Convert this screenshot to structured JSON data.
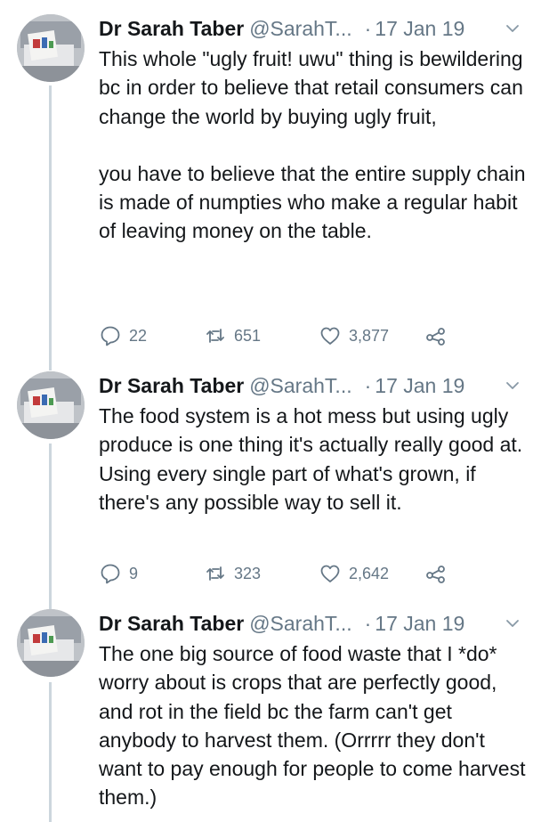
{
  "tweets": [
    {
      "author_name": "Dr Sarah Taber",
      "author_handle": "@SarahT...",
      "separator": "·",
      "date": "17 Jan 19",
      "paragraphs": [
        "This whole \"ugly fruit! uwu\" thing is bewildering bc in order to believe that retail consumers can change the world by buying ugly fruit,",
        "you have to believe that the entire supply chain is made of numpties who make a regular habit of leaving money on the table."
      ],
      "replies": "22",
      "retweets": "651",
      "likes": "3,877"
    },
    {
      "author_name": "Dr Sarah Taber",
      "author_handle": "@SarahT...",
      "separator": "·",
      "date": "17 Jan 19",
      "paragraphs": [
        "The food system is a hot mess but using ugly produce is one thing it's actually really good at. Using every single part of what's grown, if there's any possible way to sell it."
      ],
      "replies": "9",
      "retweets": "323",
      "likes": "2,642"
    },
    {
      "author_name": "Dr Sarah Taber",
      "author_handle": "@SarahT...",
      "separator": "·",
      "date": "17 Jan 19",
      "paragraphs": [
        "The one big source of food waste that I *do* worry about is crops that are perfectly good, and rot in the field bc the farm can't get anybody to harvest them. (Orrrrr they don't want to pay enough for people to come harvest them.)"
      ]
    }
  ],
  "icons": {
    "reply": "reply-icon",
    "retweet": "retweet-icon",
    "like": "heart-icon",
    "share": "share-icon",
    "caret": "chevron-down-icon"
  },
  "colors": {
    "text": "#14171a",
    "muted": "#657786",
    "thread_line": "#ccd6dd",
    "background": "#ffffff"
  }
}
